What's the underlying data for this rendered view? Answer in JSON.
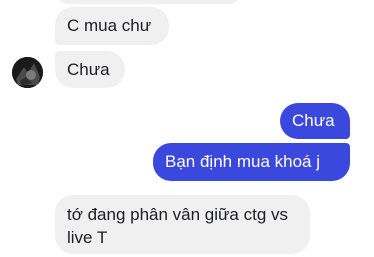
{
  "messages": [
    {
      "direction": "incoming",
      "text": "C mua chư"
    },
    {
      "direction": "incoming",
      "text": "Chưa"
    },
    {
      "direction": "outgoing",
      "text": "Chưa"
    },
    {
      "direction": "outgoing",
      "text": "Bạn định mua khoá j"
    },
    {
      "direction": "incoming",
      "text": "tớ đang phân vân giữa ctg vs live T"
    }
  ],
  "colors": {
    "incoming_bubble": "#f1f0f0",
    "outgoing_bubble": "#3b48dd"
  },
  "icons": {
    "avatar": "contact-avatar"
  }
}
